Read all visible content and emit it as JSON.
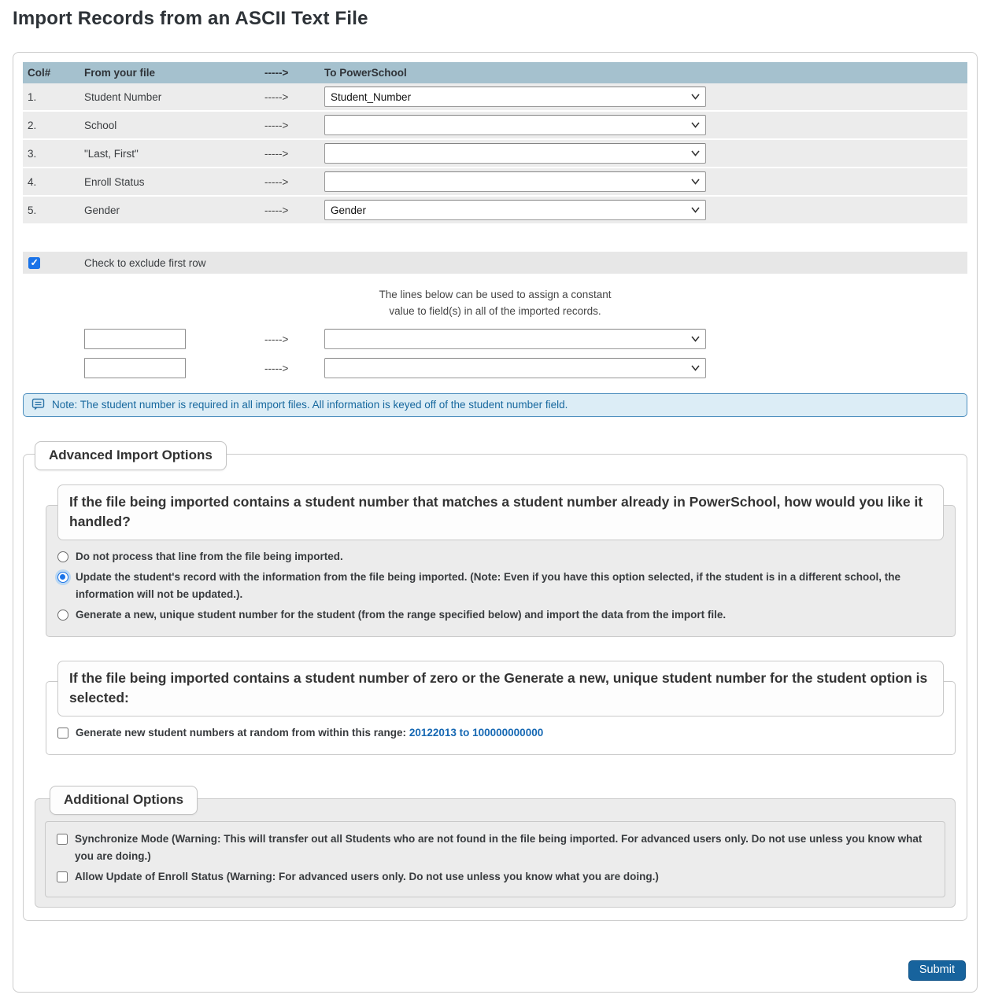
{
  "page": {
    "title": "Import Records from an ASCII Text File"
  },
  "mapping": {
    "headers": {
      "col": "Col#",
      "from": "From your file",
      "arrow": "----->",
      "to": "To PowerSchool"
    },
    "rows": [
      {
        "num": "1.",
        "label": "Student Number",
        "arrow": "----->",
        "selected": "Student_Number"
      },
      {
        "num": "2.",
        "label": "School",
        "arrow": "----->",
        "selected": ""
      },
      {
        "num": "3.",
        "label": "\"Last, First\"",
        "arrow": "----->",
        "selected": ""
      },
      {
        "num": "4.",
        "label": "Enroll Status",
        "arrow": "----->",
        "selected": ""
      },
      {
        "num": "5.",
        "label": "Gender",
        "arrow": "----->",
        "selected": "Gender"
      }
    ]
  },
  "exclude_first_row": {
    "label": "Check to exclude first row",
    "checked": true
  },
  "constant_assign": {
    "note_line1": "The lines below can be used to assign a constant",
    "note_line2": "value to field(s) in all of the imported records.",
    "rows": [
      {
        "value": "",
        "arrow": "----->",
        "selected": ""
      },
      {
        "value": "",
        "arrow": "----->",
        "selected": ""
      }
    ]
  },
  "note": {
    "icon": "note-comment-icon",
    "text": "Note: The student number is required in all import files. All information is keyed off of the student number field."
  },
  "advanced": {
    "legend": "Advanced Import Options",
    "match_question": "If the file being imported contains a student number that matches a student number already in PowerSchool, how would you like it handled?",
    "match_options": [
      {
        "label": "Do not process that line from the file being imported.",
        "selected": false
      },
      {
        "label": "Update the student's record with the information from the file being imported. (Note: Even if you have this option selected, if the student is in a different school, the information will not be updated.).",
        "selected": true
      },
      {
        "label": "Generate a new, unique student number for the student (from the range specified below) and import the data from the import file.",
        "selected": false
      }
    ],
    "zero_question": "If the file being imported contains a student number of zero or the Generate a new, unique student number for the student option is selected:",
    "zero_checkbox": {
      "label": "Generate new student numbers at random from within this range: ",
      "range": "20122013 to 100000000000",
      "checked": false
    },
    "additional": {
      "legend": "Additional Options",
      "options": [
        {
          "label": "Synchronize Mode (Warning: This will transfer out all Students who are not found in the file being imported. For advanced users only. Do not use unless you know what you are doing.)",
          "checked": false
        },
        {
          "label": "Allow Update of Enroll Status (Warning: For advanced users only. Do not use unless you know what you are doing.)",
          "checked": false
        }
      ]
    }
  },
  "submit": {
    "label": "Submit"
  },
  "colors": {
    "table_header_bg": "#a5c1ce",
    "row_bg": "#ececec",
    "note_bg": "#dcedf6",
    "note_border": "#4c8ebe",
    "note_text": "#17689e",
    "control_accent": "#1a73e8",
    "range_link": "#1668b3",
    "submit_bg": "#17639d"
  }
}
